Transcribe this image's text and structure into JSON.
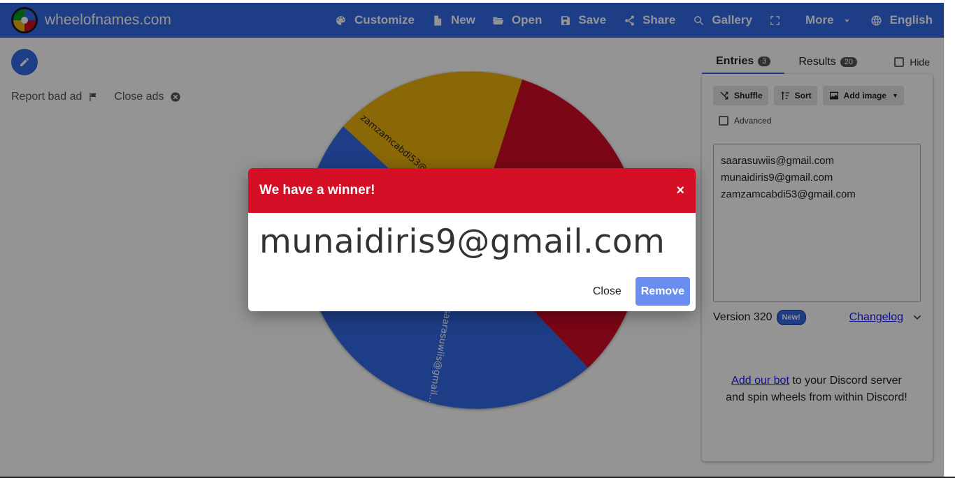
{
  "header": {
    "site_name": "wheelofnames.com",
    "nav": [
      {
        "label": "Customize",
        "icon": "palette-icon"
      },
      {
        "label": "New",
        "icon": "file-icon"
      },
      {
        "label": "Open",
        "icon": "folder-open-icon"
      },
      {
        "label": "Save",
        "icon": "save-icon"
      },
      {
        "label": "Share",
        "icon": "share-icon"
      },
      {
        "label": "Gallery",
        "icon": "search-icon"
      },
      {
        "label": "",
        "icon": "fullscreen-icon"
      },
      {
        "label": "More",
        "icon": "chevron-down-icon"
      },
      {
        "label": "English",
        "icon": "globe-icon"
      }
    ]
  },
  "left": {
    "report_label": "Report bad ad",
    "close_ads_label": "Close ads"
  },
  "wheel": {
    "segments": [
      {
        "label": "saarasuwiis@gmail...",
        "color": "#3369e8"
      },
      {
        "label": "zamzamcabdi53@gma...",
        "color": "#eeb211"
      },
      {
        "label": "munaidiris9@gmail.com",
        "color": "#d50f25"
      }
    ]
  },
  "panel": {
    "tabs": [
      {
        "label": "Entries",
        "count": "3"
      },
      {
        "label": "Results",
        "count": "20"
      }
    ],
    "hide_label": "Hide",
    "tools": {
      "shuffle": "Shuffle",
      "sort": "Sort",
      "add_image": "Add image"
    },
    "advanced_label": "Advanced",
    "entries": [
      "saarasuwiis@gmail.com",
      "munaidiris9@gmail.com",
      "zamzamcabdi53@gmail.com"
    ],
    "version_label": "Version 320",
    "new_badge": "New!",
    "changelog_label": "Changelog",
    "discord_link": "Add our bot",
    "discord_text_1": " to your Discord server and spin wheels from within Discord!"
  },
  "modal": {
    "title": "We have a winner!",
    "close_x": "×",
    "winner": "munaidiris9@gmail.com",
    "close_label": "Close",
    "remove_label": "Remove"
  },
  "colors": {
    "brand_blue": "#3369e8",
    "winner_red": "#d50f25",
    "remove_button": "#6a8ef0"
  }
}
